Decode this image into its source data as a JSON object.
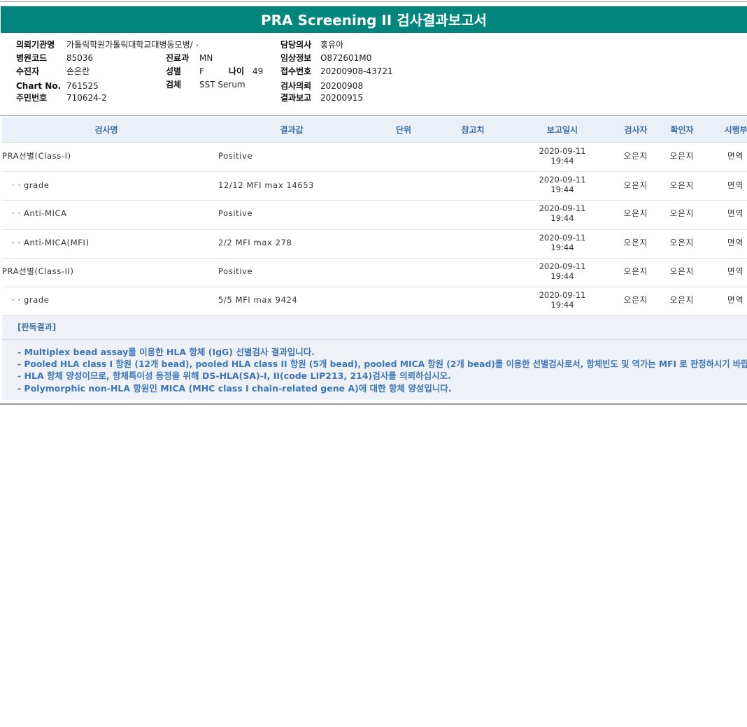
{
  "title": "PRA Screening II 검사결과보고서",
  "info": {
    "institution": {
      "label": "의뢰기관명",
      "value": "가톨릭학원가톨릭대학교대병동모병/ -"
    },
    "hospital_code": {
      "label": "병원코드",
      "value": "85036"
    },
    "patient": {
      "label": "수진자",
      "value": "손은란"
    },
    "chart_no": {
      "label": "Chart No.",
      "value": "761525"
    },
    "resident_no": {
      "label": "주민번호",
      "value": "710624-2"
    },
    "department": {
      "label": "진료과",
      "value": "MN"
    },
    "sex": {
      "label": "성별",
      "value": "F"
    },
    "age": {
      "label": "나이",
      "value": "49"
    },
    "specimen": {
      "label": "검체",
      "value": "SST Serum"
    },
    "doctor": {
      "label": "담당의사",
      "value": "홍유아"
    },
    "clinical_info": {
      "label": "임상정보",
      "value": "O872601M0"
    },
    "receipt_no": {
      "label": "접수번호",
      "value": "20200908-43721"
    },
    "request_date": {
      "label": "검사의뢰",
      "value": "20200908"
    },
    "report_date": {
      "label": "결과보고",
      "value": "20200915"
    }
  },
  "table": {
    "headers": {
      "name": "검사명",
      "result": "결과값",
      "unit": "단위",
      "reference": "참고치",
      "report_time": "보고일시",
      "tester": "검사자",
      "confirmer": "확인자",
      "department": "시행부"
    },
    "rows": [
      {
        "name": "PRA선별(Class-I)",
        "result": "Positive",
        "date": "2020-09-11",
        "time": "19:44",
        "tester": "오은지",
        "confirmer": "오은지",
        "dept": "면역"
      },
      {
        "name": "· · grade",
        "result": "12/12 MFI max 14653",
        "date": "2020-09-11",
        "time": "19:44",
        "tester": "오은지",
        "confirmer": "오은지",
        "dept": "면역"
      },
      {
        "name": "· · Anti-MICA",
        "result": "Positive",
        "date": "2020-09-11",
        "time": "19:44",
        "tester": "오은지",
        "confirmer": "오은지",
        "dept": "면역"
      },
      {
        "name": "· · Anti-MICA(MFI)",
        "result": "2/2 MFI max 278",
        "date": "2020-09-11",
        "time": "19:44",
        "tester": "오은지",
        "confirmer": "오은지",
        "dept": "면역"
      },
      {
        "name": "PRA선별(Class-II)",
        "result": "Positive",
        "date": "2020-09-11",
        "time": "19:44",
        "tester": "오은지",
        "confirmer": "오은지",
        "dept": "면역"
      },
      {
        "name": "· · grade",
        "result": "5/5 MFI max 9424",
        "date": "2020-09-11",
        "time": "19:44",
        "tester": "오은지",
        "confirmer": "오은지",
        "dept": "면역"
      }
    ]
  },
  "interpretation": {
    "title": "[판독결과]",
    "lines": [
      "- Multiplex bead assay를 이용한 HLA 항체 (IgG) 선별검사 결과입니다.",
      "- Pooled HLA class I 항원 (12개 bead), pooled HLA class II 항원 (5개 bead), pooled MICA 항원 (2개 bead)를 이용한 선별검사로서, 항체빈도 및 역가는 MFI 로 판정하시기 바랍니다.",
      "- HLA 항체 양성이므로, 항체특이성 동정을 위해 DS-HLA(SA)-I, II(code LIP213, 214)검사를 의뢰하십시오.",
      "- Polymorphic non-HLA 항원인 MICA (MHC class I chain-related gene A)에 대한 항체 양성입니다."
    ]
  },
  "colors": {
    "banner": "#00857f",
    "header_text": "#3d6da0",
    "interp_text": "#3d75b8",
    "header_bg": "#e9f0f7",
    "interp_bg": "#eef2f6"
  }
}
